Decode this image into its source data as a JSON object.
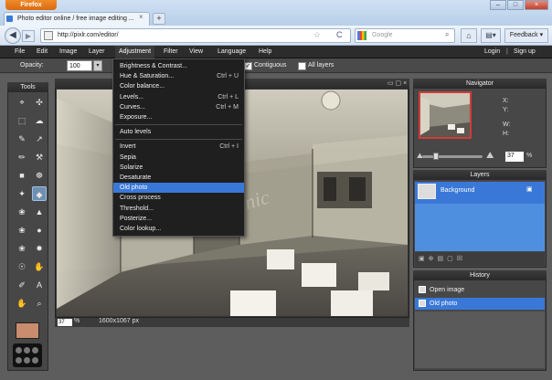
{
  "browser": {
    "app_button": "Firefox",
    "tab_title": "Photo editor online / free image editing ...",
    "new_tab": "+",
    "url": "http://pixlr.com/editor/",
    "search_placeholder": "Google",
    "feedback_label": "Feedback ▾",
    "back": "◀",
    "forward": "▶",
    "star": "☆",
    "reload": "C",
    "home": "⌂",
    "bookmarks": "▤▾",
    "magnifier": "⌕",
    "tab_close": "×",
    "win_min": "–",
    "win_max": "□",
    "win_close": "×"
  },
  "menubar": {
    "items": [
      "File",
      "Edit",
      "Image",
      "Layer",
      "Adjustment",
      "Filter",
      "View",
      "Language",
      "Help"
    ],
    "login": "Login",
    "separator": "|",
    "signup": "Sign up"
  },
  "options": {
    "opacity_label": "Opacity:",
    "opacity_value": "100",
    "contiguous_label": "Contiguous",
    "all_layers_label": "All layers",
    "checkmark": "✓"
  },
  "tools": {
    "title": "Tools",
    "icons": [
      "⌖",
      "✣",
      "⬚",
      "☁",
      "✎",
      "↗",
      "✏",
      "⚒",
      "■",
      "☸",
      "✦",
      "◆",
      "❀",
      "▲",
      "❀",
      "●",
      "❀",
      "✸",
      "☉",
      "✋",
      "✐",
      "A",
      "✋",
      "⌕"
    ]
  },
  "adjustment_menu": {
    "groups": [
      [
        {
          "label": "Brightness & Contrast...",
          "shortcut": ""
        },
        {
          "label": "Hue & Saturation...",
          "shortcut": "Ctrl + U"
        },
        {
          "label": "Color balance...",
          "shortcut": ""
        },
        {
          "label": "Levels...",
          "shortcut": "Ctrl + L"
        },
        {
          "label": "Curves...",
          "shortcut": "Ctrl + M"
        },
        {
          "label": "Exposure...",
          "shortcut": ""
        }
      ],
      [
        {
          "label": "Auto levels",
          "shortcut": ""
        }
      ],
      [
        {
          "label": "Invert",
          "shortcut": "Ctrl + I"
        },
        {
          "label": "Sepia",
          "shortcut": ""
        },
        {
          "label": "Solarize",
          "shortcut": ""
        },
        {
          "label": "Desaturate",
          "shortcut": ""
        },
        {
          "label": "Old photo",
          "shortcut": "",
          "highlighted": true
        },
        {
          "label": "Cross process",
          "shortcut": ""
        },
        {
          "label": "Threshold...",
          "shortcut": ""
        },
        {
          "label": "Posterize...",
          "shortcut": ""
        },
        {
          "label": "Color lookup...",
          "shortcut": ""
        }
      ]
    ]
  },
  "canvas": {
    "zoom": "37",
    "zoom_unit": "%",
    "size": "1600x1067 px",
    "controls": "▭ ▢ ×"
  },
  "navigator": {
    "title": "Navigator",
    "x_label": "X:",
    "y_label": "Y:",
    "w_label": "W:",
    "h_label": "H:",
    "zoom": "37",
    "zoom_unit": "%"
  },
  "layers": {
    "title": "Layers",
    "items": [
      "Background"
    ],
    "lock": "▣",
    "footer_icons": "▣⊕▤▢☒"
  },
  "history": {
    "title": "History",
    "items": [
      "Open image",
      "Old photo"
    ],
    "selected_index": 1
  },
  "colors": {
    "accent": "#3a78d8",
    "foreground_color": "#c98c6e",
    "menu_bg": "#2c2c2c",
    "nav_frame": "#d43a3a"
  }
}
